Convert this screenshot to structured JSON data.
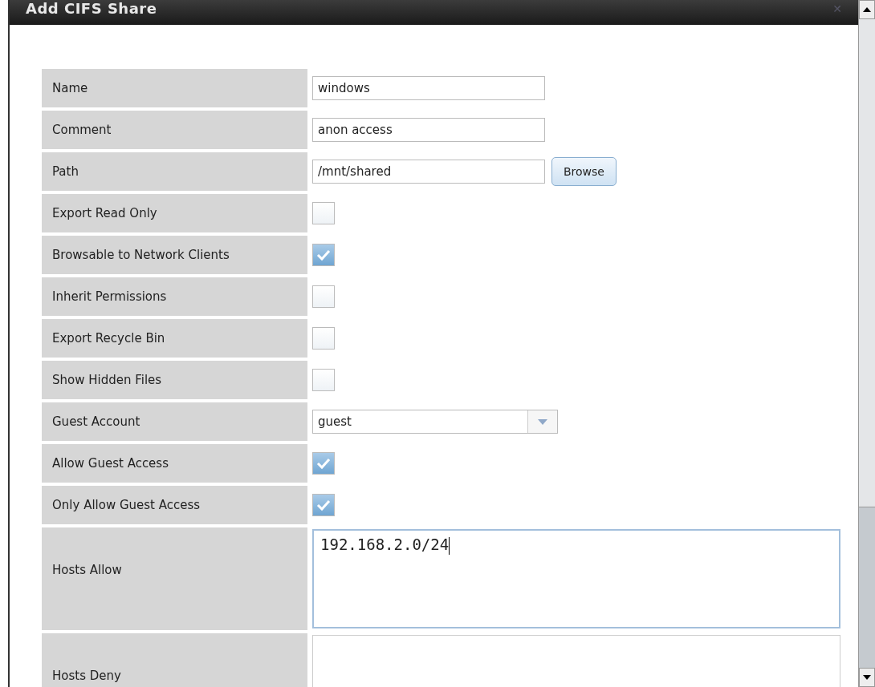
{
  "dialog": {
    "title": "Add CIFS Share",
    "close": "✕"
  },
  "fields": [
    {
      "kind": "text",
      "label": "Name",
      "value": "windows"
    },
    {
      "kind": "text",
      "label": "Comment",
      "value": "anon access"
    },
    {
      "kind": "path",
      "label": "Path",
      "value": "/mnt/shared",
      "button": "Browse"
    },
    {
      "kind": "checkbox",
      "label": "Export Read Only",
      "checked": false
    },
    {
      "kind": "checkbox",
      "label": "Browsable to Network Clients",
      "checked": true
    },
    {
      "kind": "checkbox",
      "label": "Inherit Permissions",
      "checked": false
    },
    {
      "kind": "checkbox",
      "label": "Export Recycle Bin",
      "checked": false
    },
    {
      "kind": "checkbox",
      "label": "Show Hidden Files",
      "checked": false
    },
    {
      "kind": "select",
      "label": "Guest Account",
      "value": "guest"
    },
    {
      "kind": "checkbox",
      "label": "Allow Guest Access",
      "checked": true
    },
    {
      "kind": "checkbox",
      "label": "Only Allow Guest Access",
      "checked": true
    },
    {
      "kind": "textarea",
      "label": "Hosts Allow",
      "value": "192.168.2.0/24",
      "focused": true
    },
    {
      "kind": "textarea",
      "label": "Hosts Deny",
      "focused": false
    }
  ]
}
